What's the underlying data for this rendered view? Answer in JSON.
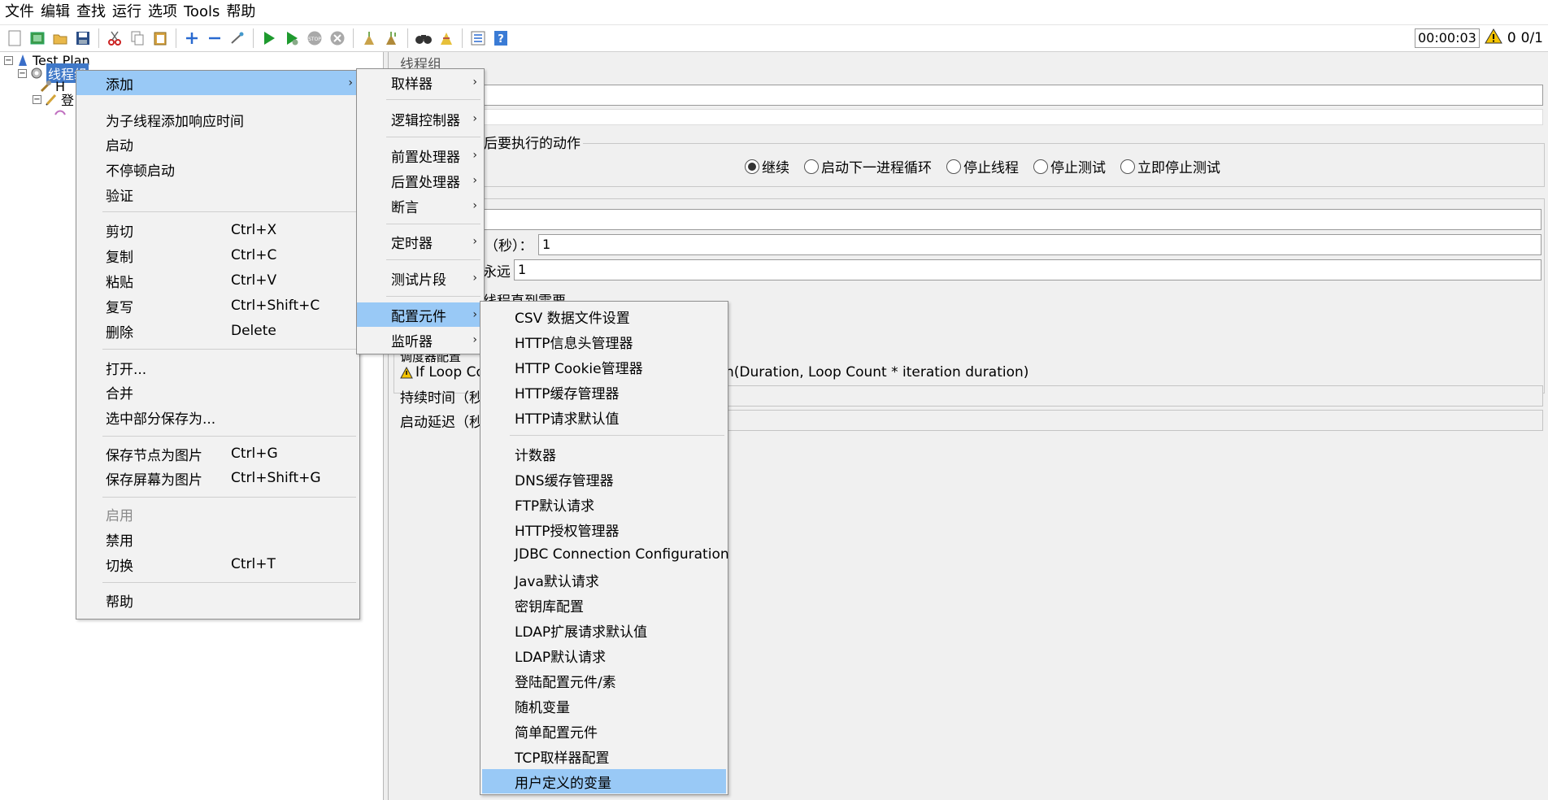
{
  "menubar": [
    "文件",
    "编辑",
    "查找",
    "运行",
    "选项",
    "Tools",
    "帮助"
  ],
  "toolbar": {
    "icons": [
      "new-icon",
      "templates-icon",
      "open-icon",
      "save-icon",
      "cut-icon",
      "copy-icon",
      "paste-icon",
      "expand-icon",
      "collapse-icon",
      "toggle-icon",
      "start-icon",
      "start-no-pause-icon",
      "stop-icon",
      "shutdown-icon",
      "clear-icon",
      "clear-all-icon",
      "search-icon",
      "reset-search-icon",
      "function-helper-icon",
      "help-icon"
    ],
    "timer": "00:00:03",
    "warning_count": "0",
    "threads": "0/1"
  },
  "tree": {
    "root": "Test Plan",
    "selected": "线程组",
    "child1": "H",
    "child2": "登"
  },
  "right": {
    "title": "线程组",
    "action_label": "后要执行的动作",
    "radios": [
      "继续",
      "启动下一进程循环",
      "停止线程",
      "停止测试",
      "立即停止测试"
    ],
    "ramp_label": "（秒）：",
    "ramp_value": "1",
    "loop_label": "永远",
    "loop_value": "1",
    "delay_label": "线程直到需要",
    "scheduler_label": "调度器配置",
    "warning_text": "If Loop Co",
    "warning_tail": "n(Duration, Loop Count * iteration duration)",
    "duration_label": "持续时间（秒",
    "startup_label": "启动延迟（秒"
  },
  "menu1": {
    "items": [
      {
        "label": "添加",
        "arrow": true,
        "hl": true
      },
      {
        "label": "为子线程添加响应时间"
      },
      {
        "label": "启动"
      },
      {
        "label": "不停顿启动"
      },
      {
        "label": "验证"
      },
      {
        "label": "剪切",
        "shortcut": "Ctrl+X"
      },
      {
        "label": "复制",
        "shortcut": "Ctrl+C"
      },
      {
        "label": "粘贴",
        "shortcut": "Ctrl+V"
      },
      {
        "label": "复写",
        "shortcut": "Ctrl+Shift+C"
      },
      {
        "label": "删除",
        "shortcut": "Delete"
      },
      {
        "label": "打开..."
      },
      {
        "label": "合并"
      },
      {
        "label": "选中部分保存为..."
      },
      {
        "label": "保存节点为图片",
        "shortcut": "Ctrl+G"
      },
      {
        "label": "保存屏幕为图片",
        "shortcut": "Ctrl+Shift+G"
      },
      {
        "label": "启用",
        "disabled": true
      },
      {
        "label": "禁用"
      },
      {
        "label": "切换",
        "shortcut": "Ctrl+T"
      },
      {
        "label": "帮助"
      }
    ]
  },
  "menu2": {
    "items": [
      "取样器",
      "逻辑控制器",
      "前置处理器",
      "后置处理器",
      "断言",
      "定时器",
      "测试片段",
      "配置元件",
      "监听器"
    ]
  },
  "menu3": {
    "items": [
      "CSV 数据文件设置",
      "HTTP信息头管理器",
      "HTTP Cookie管理器",
      "HTTP缓存管理器",
      "HTTP请求默认值",
      "计数器",
      "DNS缓存管理器",
      "FTP默认请求",
      "HTTP授权管理器",
      "JDBC Connection Configuration",
      "Java默认请求",
      "密钥库配置",
      "LDAP扩展请求默认值",
      "LDAP默认请求",
      "登陆配置元件/素",
      "随机变量",
      "简单配置元件",
      "TCP取样器配置",
      "用户定义的变量"
    ]
  },
  "colors": {
    "highlight": "#99c9f6",
    "tree_selection": "#3f78c8"
  }
}
